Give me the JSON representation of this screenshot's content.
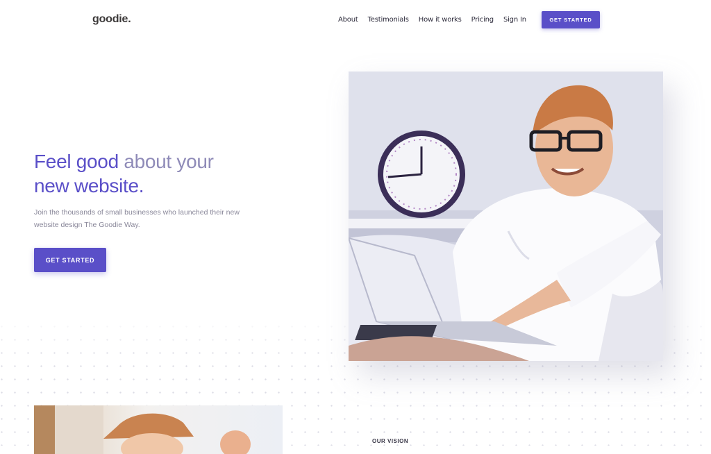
{
  "brand": {
    "logo": "goodie."
  },
  "nav": {
    "items": [
      "About",
      "Testimonials",
      "How it works",
      "Pricing",
      "Sign In"
    ],
    "cta": "GET STARTED"
  },
  "hero": {
    "title_line1_a": "Feel good ",
    "title_line1_b": "about your",
    "title_line2": "new website.",
    "subtitle": "Join the thousands of small businesses who launched their new website design The Goodie Way.",
    "cta": "GET STARTED"
  },
  "vision": {
    "eyebrow": "OUR VISION"
  },
  "colors": {
    "accent": "#5a4fc8",
    "text_dark": "#2e2c3c",
    "muted": "#8a889a"
  },
  "images": {
    "hero": "man-with-laptop-photo",
    "section": "person-in-cap-photo"
  }
}
